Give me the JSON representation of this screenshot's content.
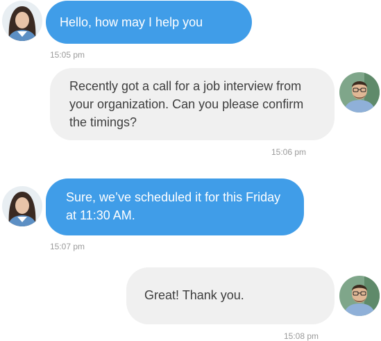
{
  "conversation": {
    "messages": [
      {
        "sender": "agent",
        "text": "Hello, how may I help you",
        "time": "15:05 pm"
      },
      {
        "sender": "user",
        "text": "Recently got a call for a job interview from your organization. Can you please confirm the timings?",
        "time": "15:06 pm"
      },
      {
        "sender": "agent",
        "text": "Sure, we’ve scheduled it for this Friday at 11:30 AM.",
        "time": "15:07 pm"
      },
      {
        "sender": "user",
        "text": "Great! Thank you.",
        "time": "15:08 pm"
      }
    ]
  },
  "colors": {
    "agent_bubble": "#409de8",
    "user_bubble": "#f0f0f0",
    "timestamp": "#9a9a9a"
  }
}
